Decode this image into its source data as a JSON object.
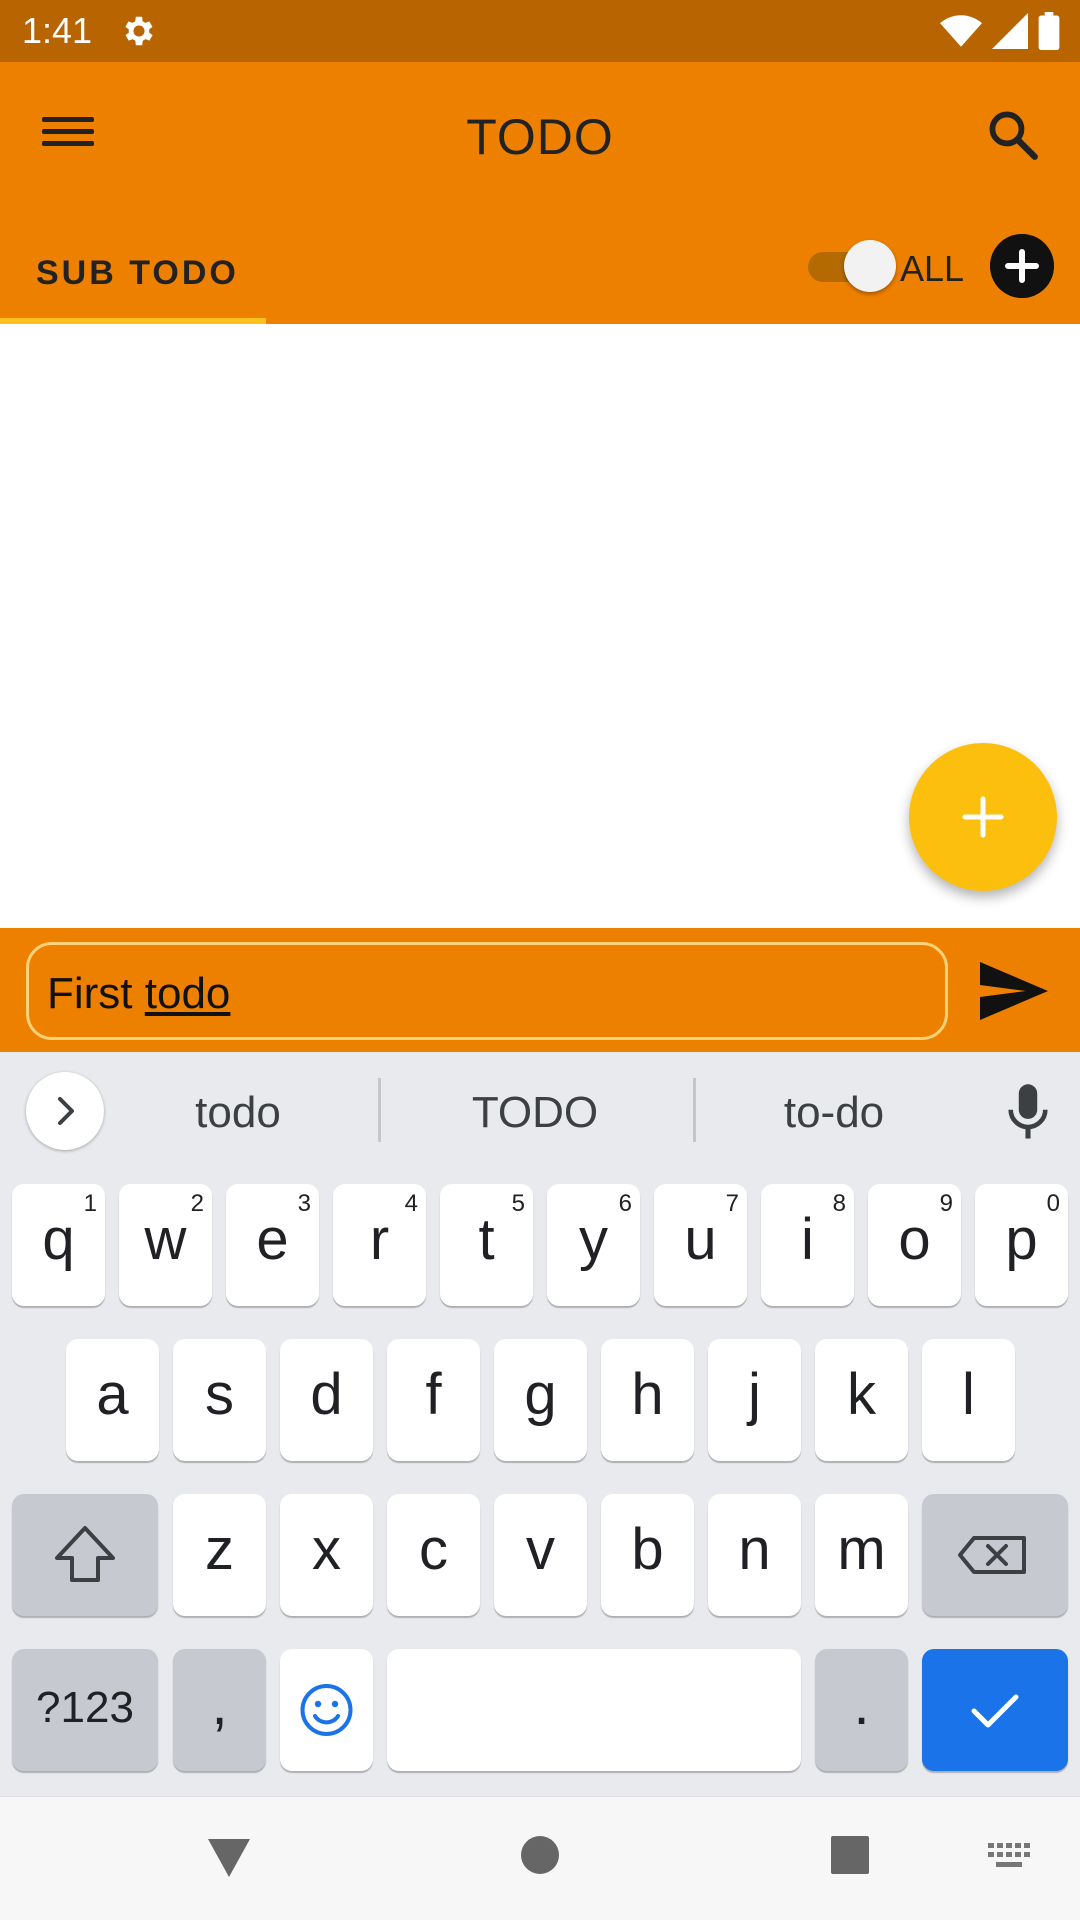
{
  "status_bar": {
    "time": "1:41",
    "icons": [
      "gear-icon",
      "wifi-icon",
      "signal-icon",
      "battery-icon"
    ]
  },
  "app_bar": {
    "title": "TODO",
    "tab_label": "SUB TODO",
    "toggle_label": "ALL",
    "toggle_on": true,
    "colors": {
      "primary": "#EE8000",
      "status": "#B86400",
      "indicator": "#FFC21A",
      "fab": "#FDBF0D"
    }
  },
  "input": {
    "text_plain": "First ",
    "text_underlined": "todo"
  },
  "keyboard": {
    "suggestions": [
      "todo",
      "TODO",
      "to-do"
    ],
    "row1": [
      {
        "c": "q",
        "h": "1"
      },
      {
        "c": "w",
        "h": "2"
      },
      {
        "c": "e",
        "h": "3"
      },
      {
        "c": "r",
        "h": "4"
      },
      {
        "c": "t",
        "h": "5"
      },
      {
        "c": "y",
        "h": "6"
      },
      {
        "c": "u",
        "h": "7"
      },
      {
        "c": "i",
        "h": "8"
      },
      {
        "c": "o",
        "h": "9"
      },
      {
        "c": "p",
        "h": "0"
      }
    ],
    "row2": [
      "a",
      "s",
      "d",
      "f",
      "g",
      "h",
      "j",
      "k",
      "l"
    ],
    "row3": [
      "z",
      "x",
      "c",
      "v",
      "b",
      "n",
      "m"
    ],
    "symbols_label": "?123",
    "comma_label": ",",
    "period_label": "."
  }
}
